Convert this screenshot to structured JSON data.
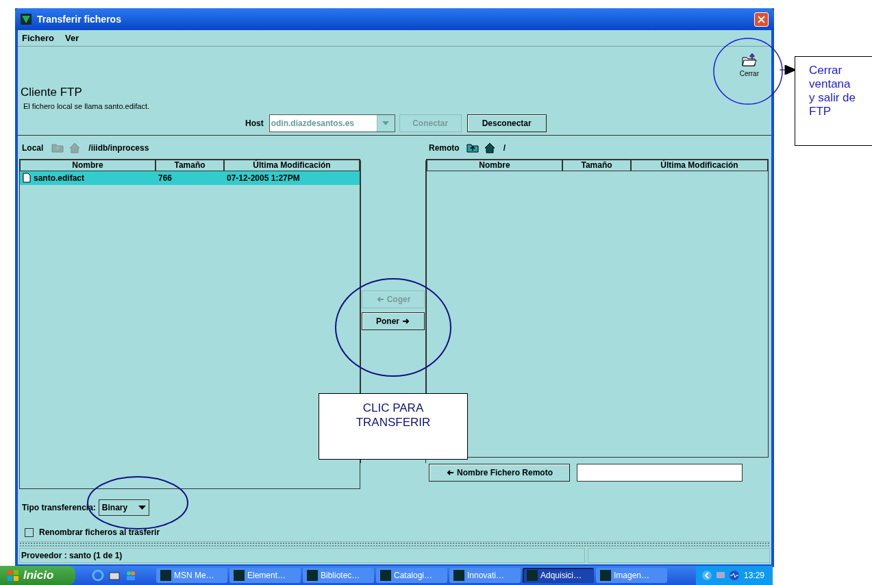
{
  "window": {
    "title": "Transferir ficheros"
  },
  "menu": [
    {
      "label": "Fichero"
    },
    {
      "label": "Ver"
    }
  ],
  "toolbar": {
    "close_label": "Cerrar"
  },
  "header": {
    "title": "Cliente FTP",
    "subtitle": "El fichero local se llama santo.edifact."
  },
  "host": {
    "label": "Host",
    "value": "odin.diazdesantos.es",
    "disabled": true
  },
  "connect_buttons": [
    {
      "label": "Conectar",
      "disabled": true
    },
    {
      "label": "Desconectar",
      "disabled": false
    }
  ],
  "local": {
    "label": "Local",
    "path": "/iiidb/inprocess",
    "columns": [
      "Nombre",
      "Tamaño",
      "Última Modificación"
    ],
    "rows": [
      {
        "name": "santo.edifact",
        "size": "766",
        "modified": "07-12-2005 1:27PM",
        "selected": true
      }
    ]
  },
  "transfer_buttons": [
    {
      "label": "Coger",
      "kind": "left",
      "disabled": true
    },
    {
      "label": "Poner",
      "kind": "right",
      "disabled": false
    }
  ],
  "remote": {
    "label": "Remoto",
    "path": "/",
    "columns": [
      "Nombre",
      "Tamaño",
      "Última Modificación"
    ],
    "rename_button": "Nombre Fichero Remoto"
  },
  "transfer_type": {
    "label": "Tipo transferencia:",
    "value": "Binary"
  },
  "rename_checkbox": {
    "label": "Renombrar ficheros al trasferir",
    "checked": false
  },
  "status_bar": [
    "Proveedor : santo (1 de 1)"
  ],
  "taskbar": {
    "start": "Inicio",
    "tasks": [
      {
        "label": "MSN Me…",
        "selected": false
      },
      {
        "label": "Element…",
        "selected": false
      },
      {
        "label": "Bibliotec…",
        "selected": false
      },
      {
        "label": "Catalogi…",
        "selected": false
      },
      {
        "label": "Innovati…",
        "selected": false
      },
      {
        "label": "Adquisici…",
        "selected": true
      },
      {
        "label": "Imagen…",
        "selected": false
      }
    ],
    "clock": "13:29"
  },
  "annotations": [
    {
      "kind": "callout",
      "text": "Cerrar ventana y salir de FTP"
    },
    {
      "kind": "note",
      "text": "CLIC PARA TRANSFERIR"
    }
  ]
}
